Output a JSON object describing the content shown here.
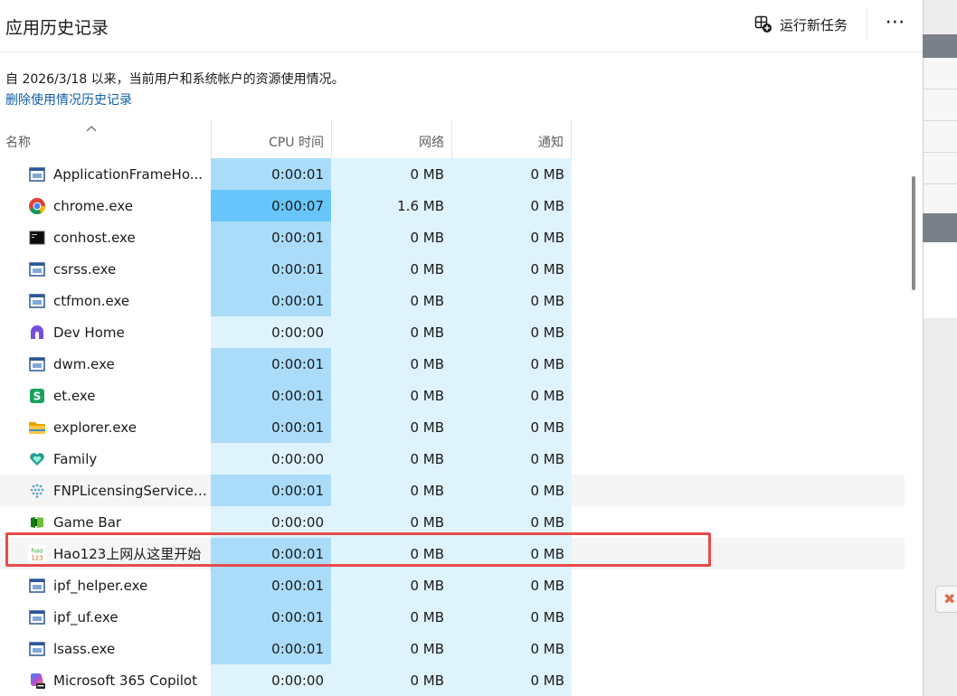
{
  "header": {
    "title": "应用历史记录",
    "run_task_label": "运行新任务",
    "more_label": "⋯"
  },
  "description": "自 2026/3/18 以来，当前用户和系统帐户的资源使用情况。",
  "delete_link": "删除使用情况历史记录",
  "columns": {
    "name": "名称",
    "cpu": "CPU 时间",
    "network": "网络",
    "notifications": "通知"
  },
  "rows": [
    {
      "name": "ApplicationFrameHo...",
      "cpu": "0:00:01",
      "network": "0 MB",
      "notifications": "0 MB",
      "icon": "window-icon"
    },
    {
      "name": "chrome.exe",
      "cpu": "0:00:07",
      "network": "1.6 MB",
      "notifications": "0 MB",
      "icon": "chrome-icon"
    },
    {
      "name": "conhost.exe",
      "cpu": "0:00:01",
      "network": "0 MB",
      "notifications": "0 MB",
      "icon": "console-icon"
    },
    {
      "name": "csrss.exe",
      "cpu": "0:00:01",
      "network": "0 MB",
      "notifications": "0 MB",
      "icon": "window-icon"
    },
    {
      "name": "ctfmon.exe",
      "cpu": "0:00:01",
      "network": "0 MB",
      "notifications": "0 MB",
      "icon": "window-icon"
    },
    {
      "name": "Dev Home",
      "cpu": "0:00:00",
      "network": "0 MB",
      "notifications": "0 MB",
      "icon": "dev-home-icon"
    },
    {
      "name": "dwm.exe",
      "cpu": "0:00:01",
      "network": "0 MB",
      "notifications": "0 MB",
      "icon": "window-icon"
    },
    {
      "name": "et.exe",
      "cpu": "0:00:01",
      "network": "0 MB",
      "notifications": "0 MB",
      "icon": "spreadsheet-icon"
    },
    {
      "name": "explorer.exe",
      "cpu": "0:00:01",
      "network": "0 MB",
      "notifications": "0 MB",
      "icon": "folder-icon"
    },
    {
      "name": "Family",
      "cpu": "0:00:00",
      "network": "0 MB",
      "notifications": "0 MB",
      "icon": "family-heart-icon"
    },
    {
      "name": "FNPLicensingService....",
      "cpu": "0:00:01",
      "network": "0 MB",
      "notifications": "0 MB",
      "icon": "license-dots-icon"
    },
    {
      "name": "Game Bar",
      "cpu": "0:00:00",
      "network": "0 MB",
      "notifications": "0 MB",
      "icon": "game-bar-icon"
    },
    {
      "name": "Hao123上网从这里开始",
      "cpu": "0:00:01",
      "network": "0 MB",
      "notifications": "0 MB",
      "icon": "hao123-icon"
    },
    {
      "name": "ipf_helper.exe",
      "cpu": "0:00:01",
      "network": "0 MB",
      "notifications": "0 MB",
      "icon": "window-icon"
    },
    {
      "name": "ipf_uf.exe",
      "cpu": "0:00:01",
      "network": "0 MB",
      "notifications": "0 MB",
      "icon": "window-icon"
    },
    {
      "name": "lsass.exe",
      "cpu": "0:00:01",
      "network": "0 MB",
      "notifications": "0 MB",
      "icon": "window-icon"
    },
    {
      "name": "Microsoft 365 Copilot",
      "cpu": "0:00:00",
      "network": "0 MB",
      "notifications": "0 MB",
      "icon": "copilot-icon"
    }
  ],
  "hao123_logo_text": "hao123",
  "colors": {
    "cpu_none": "#dff3fd",
    "cpu_low": "#aadcfa",
    "cpu_high": "#66c6fb",
    "highlight_box": "#e84b4b",
    "link": "#0e5ea8"
  },
  "background_close_glyph": "✖"
}
